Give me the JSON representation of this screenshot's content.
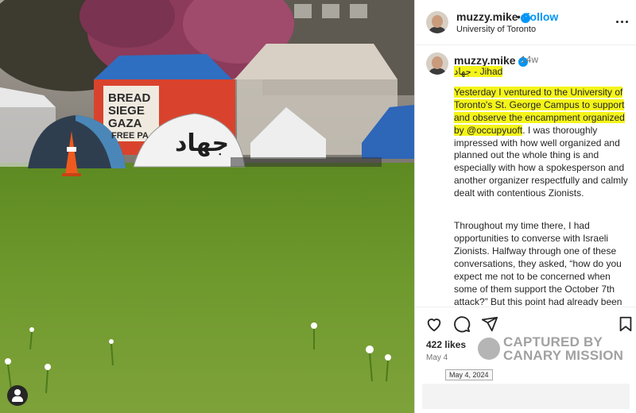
{
  "colors": {
    "accent_blue": "#0095f6",
    "highlight": "#f4f41a",
    "grass": "#6f9a2e"
  },
  "photo": {
    "tent_banner_text": [
      "BREAD",
      "SIEGE",
      "GAZA",
      "FREE PA"
    ],
    "tent_graffiti": "جهاد"
  },
  "header": {
    "username": "muzzy.mike",
    "separator": "•",
    "follow_label": "Follow",
    "location": "University of Toronto",
    "more_icon": "more-horizontal-icon"
  },
  "caption": {
    "username": "muzzy.mike",
    "time_ago": "14w",
    "line_1": "جهاد - Jihad",
    "para_1_highlight": "Yesterday I ventured to the University of Toronto's St. George Campus to support and observe the encampment organized by @occupyuoft",
    "para_1_rest": ". I was thoroughly impressed with how well organized and planned out the whole thing is and especially with how a spokesperson and another organizer respectfully and calmly dealt with contentious Zionists.",
    "para_2": "Throughout my time there, I had opportunities to converse with Israeli Zionists. Halfway through one of these conversations, they asked, “how do you expect me not to be concerned when some of them support the October 7th attack?” But this point had already been"
  },
  "actions": {
    "likes": "422 likes",
    "date": "May 4",
    "tooltip": "May 4, 2024",
    "icons": [
      "heart-icon",
      "comment-icon",
      "share-icon",
      "bookmark-icon"
    ]
  },
  "watermark": {
    "line_1": "CAPTURED BY",
    "line_2": "CANARY MISSION"
  }
}
